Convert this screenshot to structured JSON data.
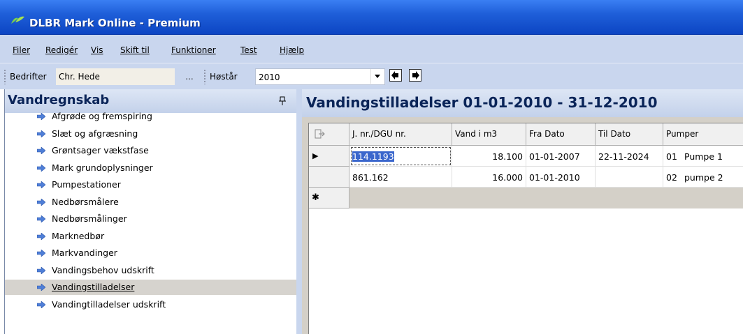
{
  "window": {
    "title": "DLBR Mark Online - Premium"
  },
  "menu": {
    "items": [
      "Filer",
      "Redigér",
      "Vis",
      "Skift til",
      "Funktioner",
      "Test",
      "Hjælp"
    ]
  },
  "toolbar": {
    "company_label": "Bedrifter",
    "company_value": "Chr. Hede",
    "ellipsis": "...",
    "harvest_year_label": "Høstår",
    "harvest_year_value": "2010",
    "prev_icon": "arrow-left-icon",
    "next_icon": "arrow-right-icon"
  },
  "left_panel": {
    "title": "Vandregnskab",
    "pin_glyph": "ᵖ",
    "items": [
      {
        "label": "Afgrøde og fremspiring"
      },
      {
        "label": "Slæt og afgræsning"
      },
      {
        "label": "Grøntsager vækstfase"
      },
      {
        "label": "Mark grundoplysninger"
      },
      {
        "label": "Pumpestationer"
      },
      {
        "label": "Nedbørsmålere"
      },
      {
        "label": "Nedbørsmålinger"
      },
      {
        "label": "Marknedbør"
      },
      {
        "label": "Markvandinger"
      },
      {
        "label": "Vandingsbehov udskrift"
      },
      {
        "label": "Vandingstilladelser",
        "selected": true
      },
      {
        "label": "Vandingtilladelser udskrift"
      }
    ]
  },
  "main": {
    "title": "Vandingstilladelser 01-01-2010 - 31-12-2010",
    "grid": {
      "columns": [
        "J. nr./DGU nr.",
        "Vand i m3",
        "Fra Dato",
        "Til Dato",
        "Pumper"
      ],
      "rows": [
        {
          "jnr": "114.1193",
          "vand": "18.100",
          "fra": "01-01-2007",
          "til": "22-11-2024",
          "pump_no": "01",
          "pump_name": "Pumpe 1"
        },
        {
          "jnr": "861.162",
          "vand": "16.000",
          "fra": "01-01-2010",
          "til": "",
          "pump_no": "02",
          "pump_name": "pumpe 2"
        }
      ],
      "row_indicator_current": "▶",
      "row_indicator_new": "✱"
    }
  },
  "colors": {
    "titlebar": "#0c45c3",
    "menubar": "#c9d6ee",
    "header_text": "#0a2458",
    "selection": "#3a66cc"
  }
}
